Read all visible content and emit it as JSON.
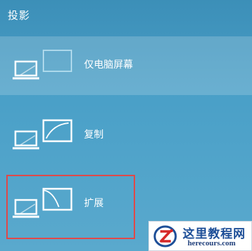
{
  "panel": {
    "title": "投影",
    "options": [
      {
        "label": "仅电脑屏幕",
        "icon": "pc-screen-only-icon",
        "selected": true
      },
      {
        "label": "复制",
        "icon": "duplicate-icon",
        "selected": false
      },
      {
        "label": "扩展",
        "icon": "extend-icon",
        "selected": false
      }
    ],
    "highlighted_option": "扩展"
  },
  "watermark": {
    "name": "这里教程网",
    "url": "herecours.com"
  },
  "colors": {
    "panel_background": "#4aa0c8",
    "highlight_border": "#e04848",
    "watermark_text": "#1e4f98"
  }
}
